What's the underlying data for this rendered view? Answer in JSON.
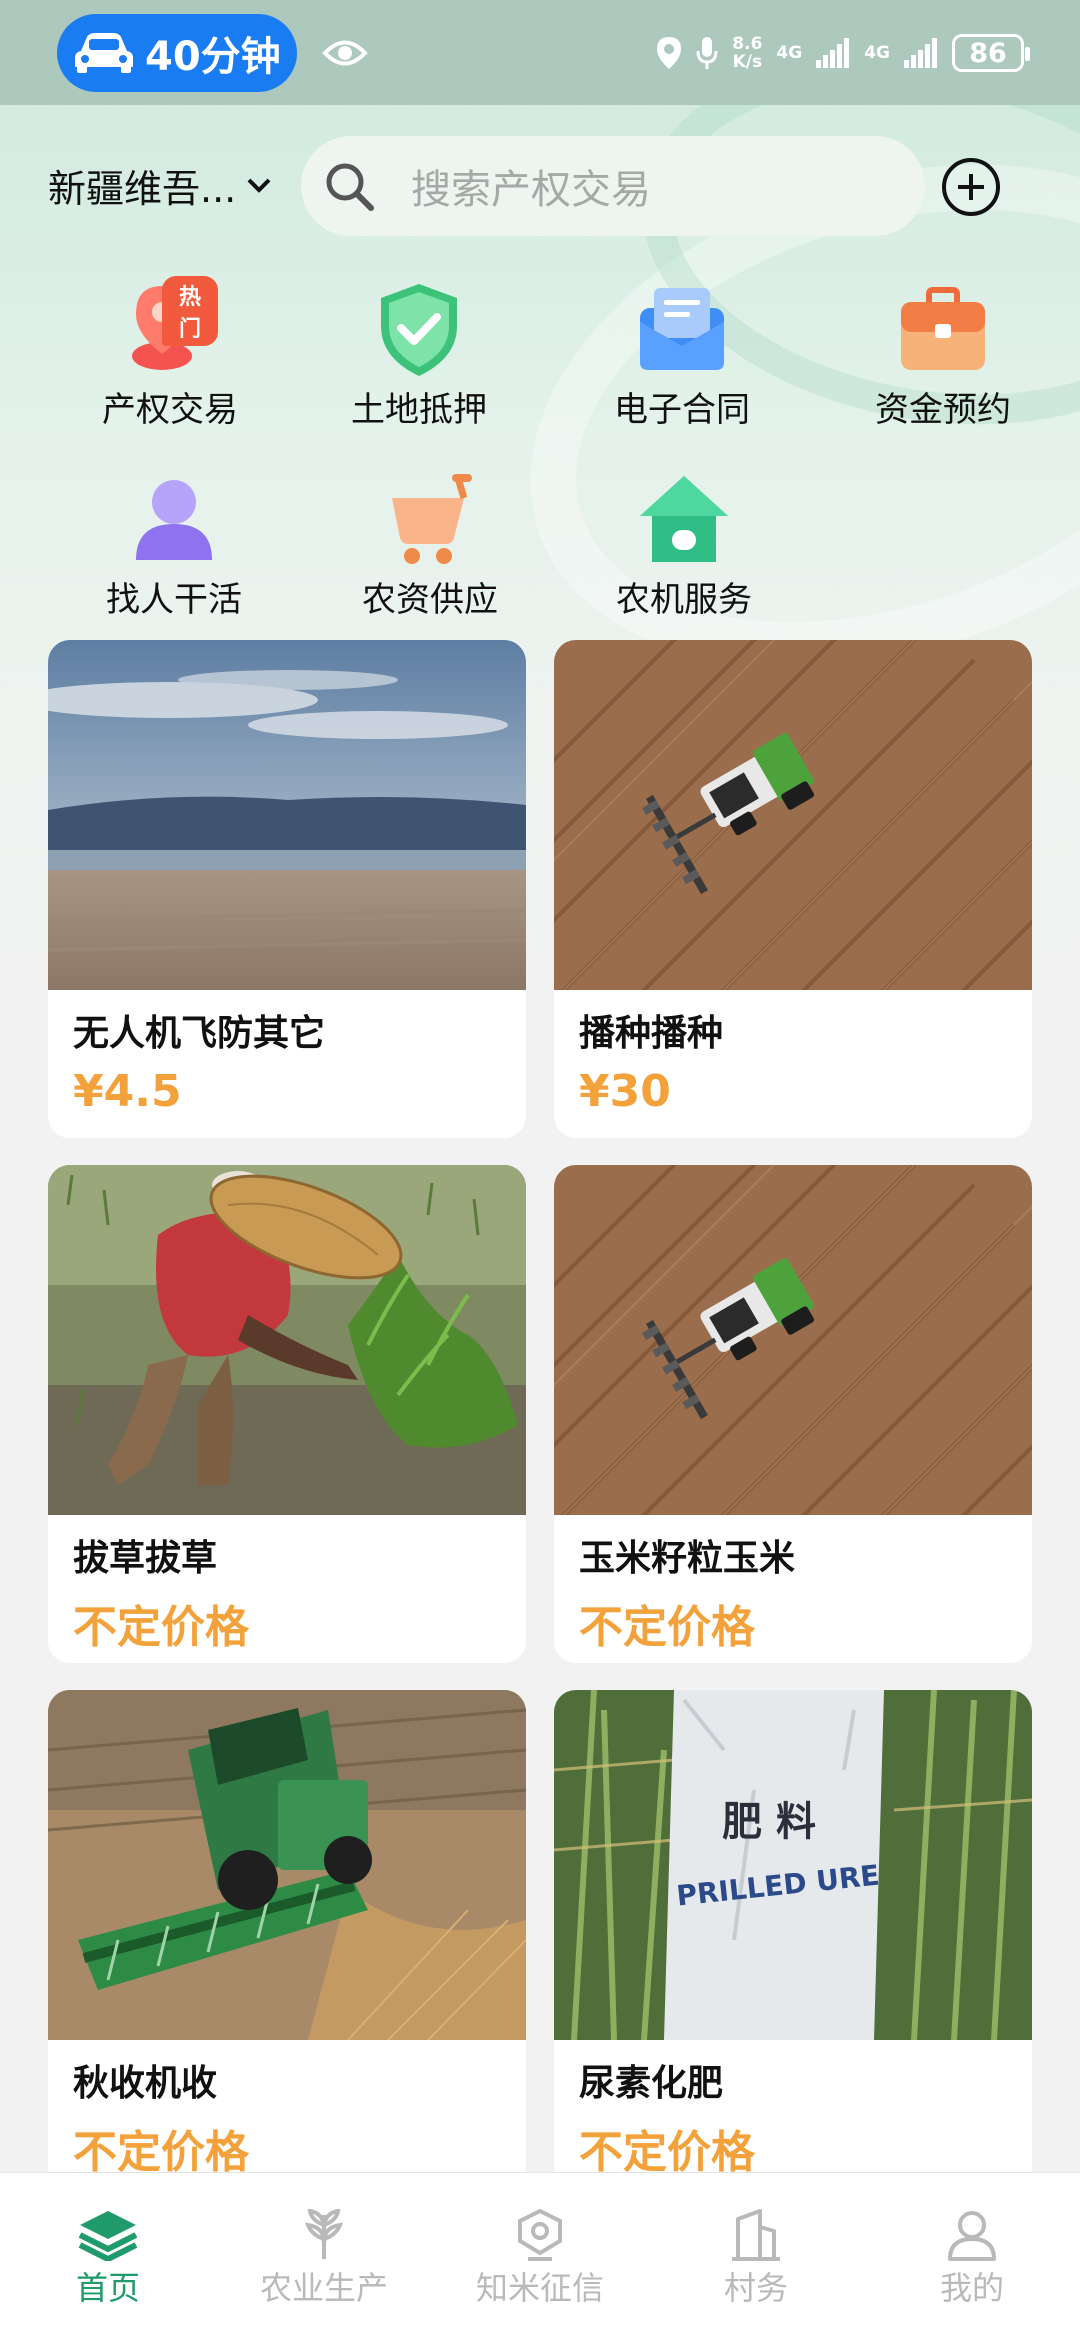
{
  "status_bar": {
    "drive_time": "40分钟",
    "net_speed_value": "8.6",
    "net_speed_unit": "K/s",
    "network_1": "4G",
    "network_2": "4G",
    "battery": "86"
  },
  "header": {
    "region": "新疆维吾...",
    "search_placeholder": "搜索产权交易"
  },
  "services": [
    {
      "label": "产权交易",
      "badge": "热门",
      "icon": "location-pin-icon"
    },
    {
      "label": "土地抵押",
      "icon": "shield-check-icon"
    },
    {
      "label": "电子合同",
      "icon": "envelope-icon"
    },
    {
      "label": "资金预约",
      "icon": "briefcase-icon"
    },
    {
      "label": "找人干活",
      "icon": "person-icon"
    },
    {
      "label": "农资供应",
      "icon": "cart-icon"
    },
    {
      "label": "农机服务",
      "icon": "house-icon"
    }
  ],
  "products": [
    {
      "title": "无人机飞防其它",
      "price": "¥4.5"
    },
    {
      "title": "播种播种",
      "price": "¥30"
    },
    {
      "title": "拔草拔草",
      "price": "不定价格"
    },
    {
      "title": "玉米籽粒玉米",
      "price": "不定价格"
    },
    {
      "title": "秋收机收",
      "price": "不定价格"
    },
    {
      "title": "尿素化肥",
      "price": "不定价格"
    }
  ],
  "fertilizer_bag_text": {
    "line1": "肥  料",
    "line2": "PRILLED URE"
  },
  "tabs": [
    {
      "label": "首页",
      "icon": "layers-icon",
      "active": true
    },
    {
      "label": "农业生产",
      "icon": "wheat-icon"
    },
    {
      "label": "知米征信",
      "icon": "badge-icon"
    },
    {
      "label": "村务",
      "icon": "building-icon"
    },
    {
      "label": "我的",
      "icon": "user-icon"
    }
  ],
  "colors": {
    "accent_green": "#1f9b6b",
    "price_orange": "#f3a13a",
    "drive_blue": "#1a7cf3"
  }
}
